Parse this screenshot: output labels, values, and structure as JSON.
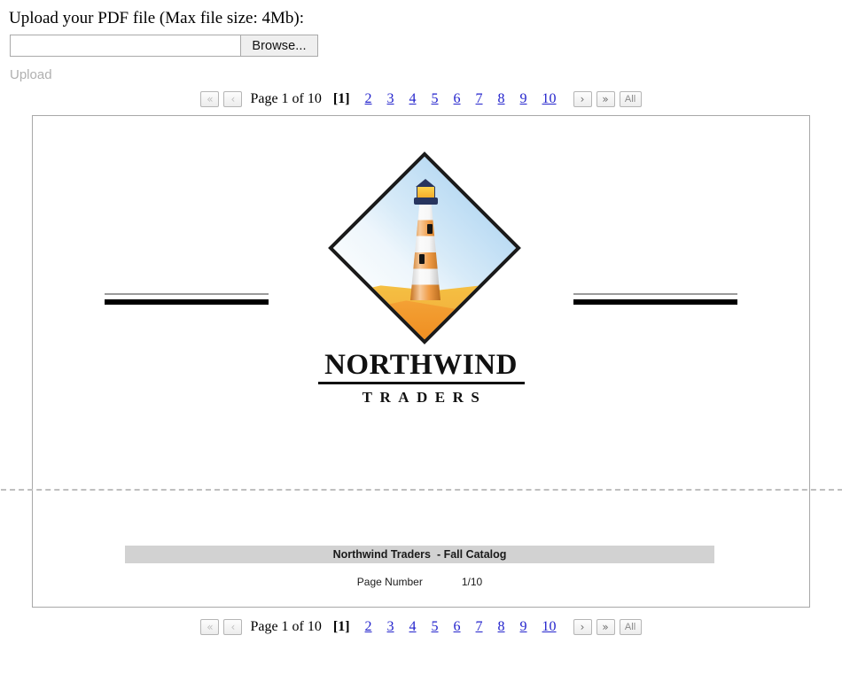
{
  "upload": {
    "label": "Upload your PDF file (Max file size: 4Mb):",
    "file_value": "",
    "file_placeholder": "",
    "browse_label": "Browse...",
    "upload_label": "Upload"
  },
  "pager": {
    "first_icon": "«",
    "prev_icon": "‹",
    "next_icon": "›",
    "last_icon": "»",
    "all_label": "All",
    "indicator": "Page 1 of 10",
    "current_page": "[1]",
    "links": [
      "2",
      "3",
      "4",
      "5",
      "6",
      "7",
      "8",
      "9",
      "10"
    ]
  },
  "document": {
    "page1": {
      "brand_name": "Northwind",
      "brand_sub": "TRADERS",
      "logo_icon": "lighthouse-diamond-logo"
    },
    "page2": {
      "header_band": "Northwind Traders  - Fall Catalog",
      "page_number_label": "Page Number",
      "page_number_value": "1/10"
    }
  },
  "colors": {
    "link": "#2222cc",
    "band": "#d2d2d2",
    "accent_orange": "#ee8b26",
    "lantern_navy": "#27355f"
  }
}
